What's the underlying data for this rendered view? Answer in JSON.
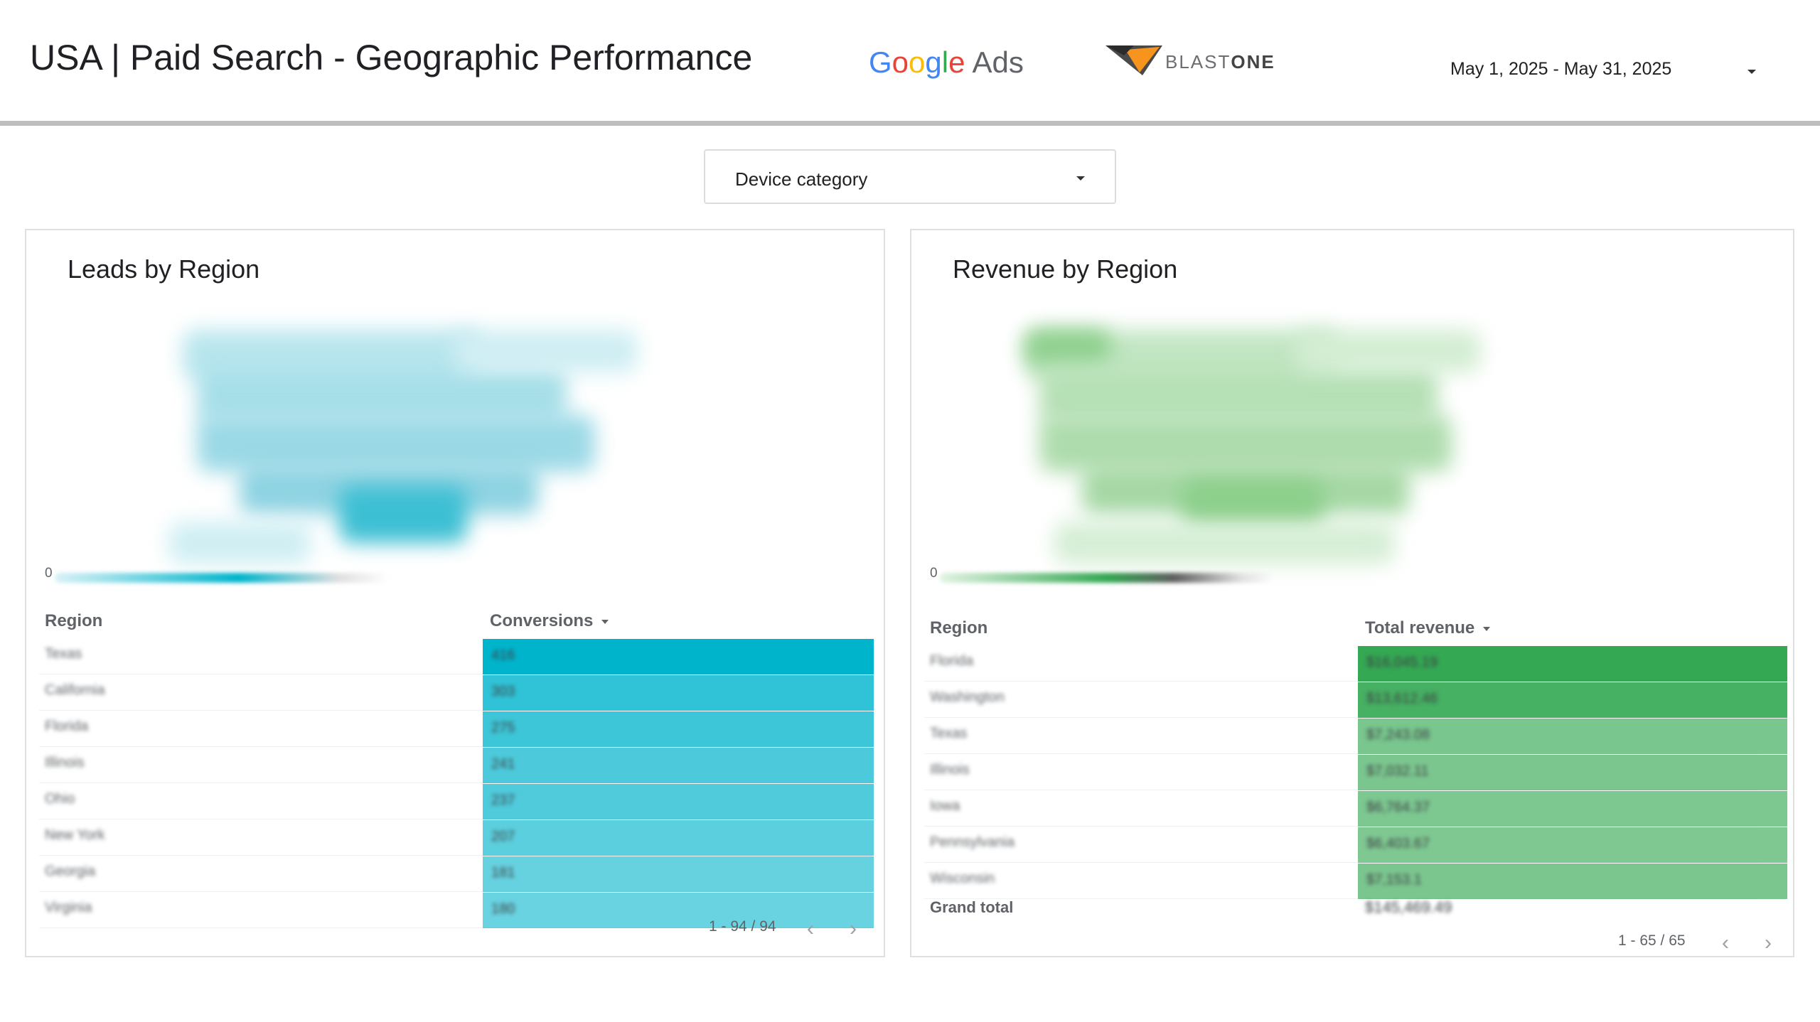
{
  "header": {
    "title": "USA | Paid Search - Geographic Performance",
    "google_ads_logo": {
      "google": "Google",
      "ads": "Ads"
    },
    "blastone_logo": {
      "blast": "BLAST",
      "one": "ONE"
    },
    "date_range": "May 1, 2025 - May 31, 2025"
  },
  "filters": {
    "device_label": "Device category"
  },
  "colors": {
    "leads_accent": "#00b4cc",
    "revenue_accent": "#34a853",
    "header_rule": "#bdbdbd"
  },
  "leads_panel": {
    "title": "Leads by Region",
    "legend_min": "0",
    "table": {
      "col_region": "Region",
      "col_metric": "Conversions",
      "rows": [
        {
          "region": "Texas",
          "value": "416",
          "level": 1.0
        },
        {
          "region": "California",
          "value": "303",
          "level": 0.73
        },
        {
          "region": "Florida",
          "value": "275",
          "level": 0.66
        },
        {
          "region": "Illinois",
          "value": "241",
          "level": 0.58
        },
        {
          "region": "Ohio",
          "value": "237",
          "level": 0.57
        },
        {
          "region": "New York",
          "value": "207",
          "level": 0.5
        },
        {
          "region": "Georgia",
          "value": "181",
          "level": 0.44
        },
        {
          "region": "Virginia",
          "value": "180",
          "level": 0.43
        }
      ]
    },
    "pager": "1 - 94 / 94"
  },
  "revenue_panel": {
    "title": "Revenue by Region",
    "legend_min": "0",
    "table": {
      "col_region": "Region",
      "col_metric": "Total revenue",
      "rows": [
        {
          "region": "Florida",
          "value": "$16,045.19",
          "level": 1.0
        },
        {
          "region": "Washington",
          "value": "$13,612.46",
          "level": 0.85
        },
        {
          "region": "Texas",
          "value": "$7,243.08",
          "level": 0.45
        },
        {
          "region": "Illinois",
          "value": "$7,032.11",
          "level": 0.44
        },
        {
          "region": "Iowa",
          "value": "$6,764.37",
          "level": 0.42
        },
        {
          "region": "Pennsylvania",
          "value": "$6,403.67",
          "level": 0.4
        },
        {
          "region": "Wisconsin",
          "value": "$7,153.1",
          "level": 0.44
        }
      ],
      "grand_total_label": "Grand total",
      "grand_total_value": "$145,469.49"
    },
    "pager": "1 - 65 / 65"
  }
}
